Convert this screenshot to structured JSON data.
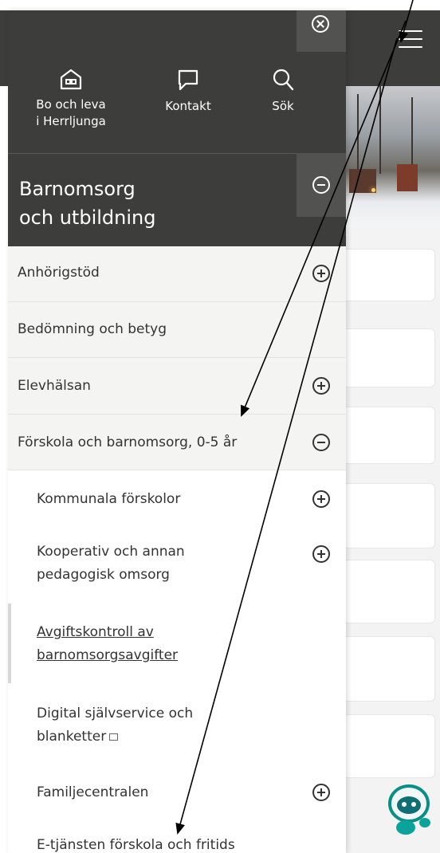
{
  "menu": {
    "quick_links": [
      {
        "label": "Bo och leva\ni Herrljunga",
        "icon": "house-icon"
      },
      {
        "label": "Kontakt",
        "icon": "chat-bubble-icon"
      },
      {
        "label": "Sök",
        "icon": "search-icon"
      }
    ],
    "section_title": "Barnomsorg\noch utbildning",
    "items": [
      {
        "label": "Anhörigstöd",
        "toggle": "plus"
      },
      {
        "label": "Bedömning och betyg",
        "toggle": "none"
      },
      {
        "label": "Elevhälsan",
        "toggle": "plus"
      },
      {
        "label": "Förskola och barnomsorg, 0-5 år",
        "toggle": "minus"
      }
    ],
    "sub_items": [
      {
        "label": "Kommunala förskolor",
        "toggle": "plus"
      },
      {
        "label": "Kooperativ och annan\npedagogisk omsorg",
        "toggle": "plus"
      },
      {
        "label": "Avgiftskontroll av\nbarnomsorgsavgifter",
        "toggle": "none",
        "active": true
      },
      {
        "label": "Digital självservice och\nblanketter",
        "toggle": "none",
        "external": true
      },
      {
        "label": "Familjecentralen",
        "toggle": "plus"
      },
      {
        "label": "E-tjänsten förskola och fritids",
        "toggle": "none"
      }
    ]
  },
  "colors": {
    "dark_header": "#3d3d3c",
    "dark_toggle": "#525251",
    "grey_item": "#f4f4f3",
    "text": "#333333"
  }
}
